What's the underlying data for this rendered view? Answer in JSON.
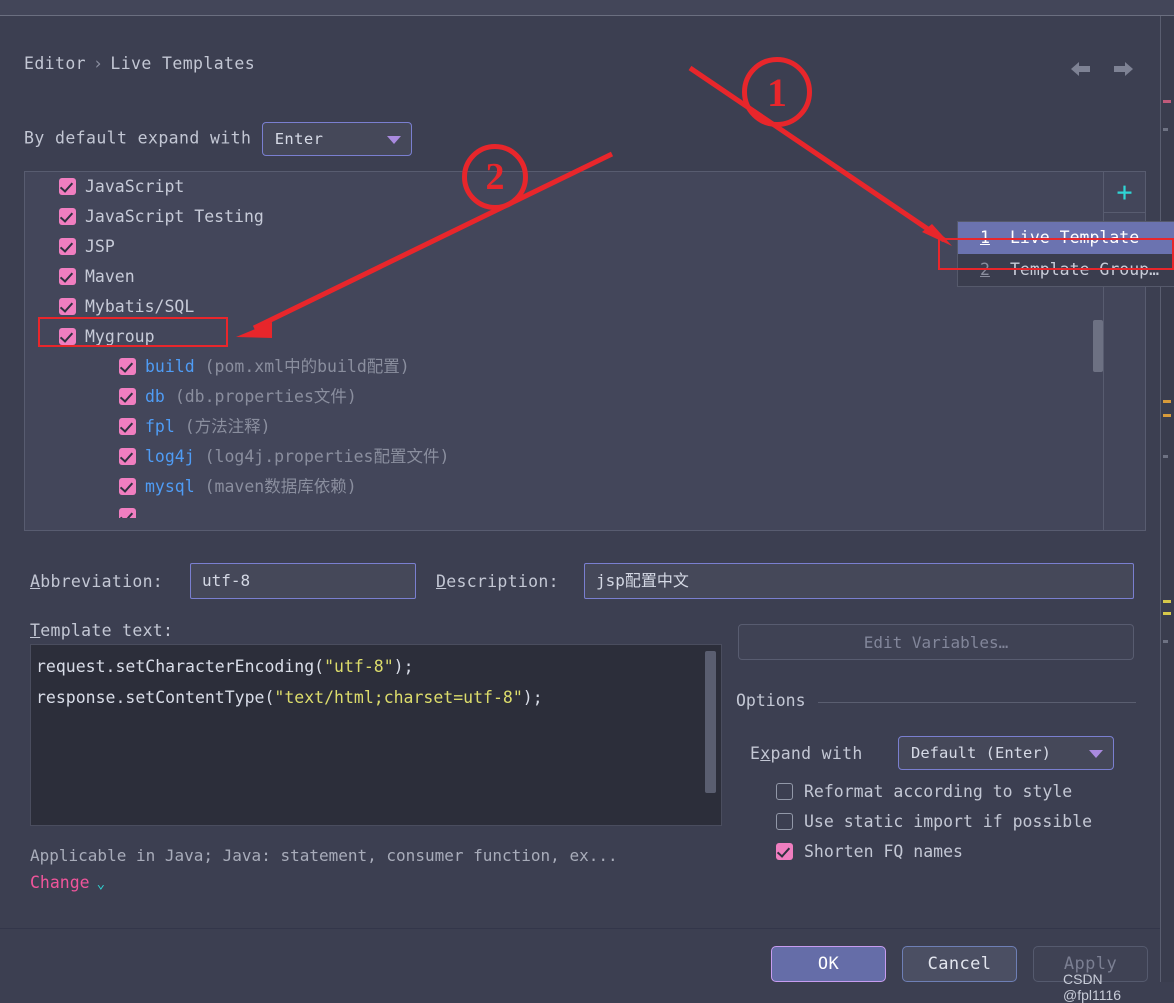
{
  "breadcrumb": {
    "root": "Editor",
    "separator": "›",
    "current": "Live Templates"
  },
  "nav": {
    "back_icon": "arrow-left-icon",
    "forward_icon": "arrow-right-icon"
  },
  "expand_default": {
    "label": "By default expand with",
    "value": "Enter"
  },
  "tree": {
    "groups": [
      {
        "label": "JavaScript",
        "checked": true,
        "expanded": false
      },
      {
        "label": "JavaScript Testing",
        "checked": true,
        "expanded": false
      },
      {
        "label": "JSP",
        "checked": true,
        "expanded": false
      },
      {
        "label": "Maven",
        "checked": true,
        "expanded": false
      },
      {
        "label": "Mybatis/SQL",
        "checked": true,
        "expanded": false
      },
      {
        "label": "Mygroup",
        "checked": true,
        "expanded": true,
        "highlighted": true
      }
    ],
    "templates": [
      {
        "name": "build",
        "desc": "(pom.xml中的build配置)",
        "checked": true
      },
      {
        "name": "db",
        "desc": "(db.properties文件)",
        "checked": true
      },
      {
        "name": "fpl",
        "desc": "(方法注释)",
        "checked": true
      },
      {
        "name": "log4j",
        "desc": "(log4j.properties配置文件)",
        "checked": true
      },
      {
        "name": "mysql",
        "desc": "(maven数据库依赖)",
        "checked": true
      }
    ],
    "toolbar": {
      "add_icon": "plus-icon",
      "reset_icon": "revert-icon"
    }
  },
  "popup": {
    "items": [
      {
        "num": "1",
        "label": "Live Template",
        "selected": true
      },
      {
        "num": "2",
        "label": "Template Group…",
        "selected": false
      }
    ]
  },
  "form": {
    "abbreviation_label": "Abbreviation:",
    "abbreviation_mnemonic": "A",
    "abbreviation_value": "utf-8",
    "description_label": "Description:",
    "description_mnemonic": "D",
    "description_value": "jsp配置中文",
    "template_text_label": "Template text:",
    "template_text_mnemonic": "T",
    "code_line_1_pre": "request.setCharacterEncoding(",
    "code_line_1_str": "\"utf-8\"",
    "code_line_1_post": ");",
    "code_line_2_pre": "response.setContentType(",
    "code_line_2_str": "\"text/html;charset=utf-8\"",
    "code_line_2_post": ");"
  },
  "options": {
    "edit_variables_label": "Edit Variables…",
    "section_title": "Options",
    "expand_with_label": "Expand with",
    "expand_with_mnemonic": "x",
    "expand_with_value": "Default (Enter)",
    "checkboxes": [
      {
        "label": "Reformat according to style",
        "checked": false
      },
      {
        "label": "Use static import if possible",
        "checked": false
      },
      {
        "label": "Shorten FQ names",
        "checked": true
      }
    ]
  },
  "applicable": {
    "text": "Applicable in Java; Java: statement, consumer function, ex...",
    "change_label": "Change",
    "change_icon": "chevron-down-icon"
  },
  "buttons": {
    "ok": "OK",
    "cancel": "Cancel",
    "apply": "Apply"
  },
  "watermark": "CSDN @fpl1116",
  "annotations": {
    "marker_1": "1",
    "marker_2": "2"
  },
  "colors": {
    "accent_red": "#e8262b",
    "checkbox_pink": "#f07ec0",
    "template_blue": "#4f9cf5",
    "link_pink": "#f0559b",
    "cyan": "#2fd5d5",
    "popup_selected": "#6b73b0"
  }
}
